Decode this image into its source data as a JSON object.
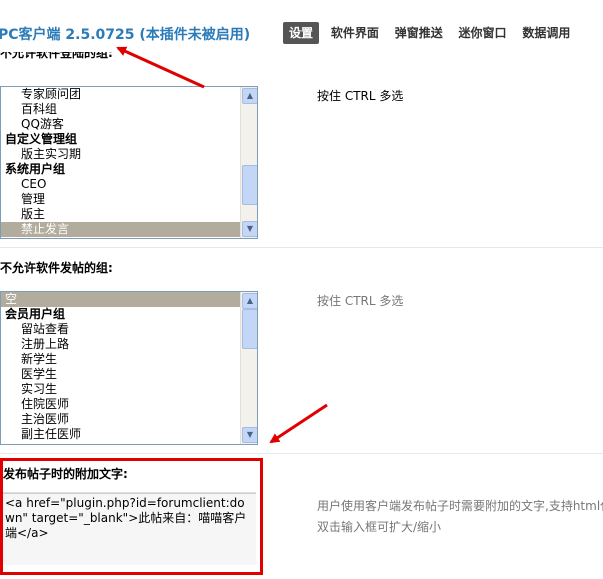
{
  "header": {
    "app_title": "PC客户端 2.5.0725 (本插件未被启用)",
    "tabs": [
      {
        "label": "设置",
        "active": true
      },
      {
        "label": "软件界面",
        "active": false
      },
      {
        "label": "弹窗推送",
        "active": false
      },
      {
        "label": "迷你窗口",
        "active": false
      },
      {
        "label": "数据调用",
        "active": false
      }
    ]
  },
  "section1": {
    "label": "不允许软件登陆的组:",
    "options": [
      {
        "text": "专家顾问团",
        "kind": "indent",
        "selected": false
      },
      {
        "text": "百科组",
        "kind": "indent",
        "selected": false
      },
      {
        "text": "QQ游客",
        "kind": "indent",
        "selected": false
      },
      {
        "text": "自定义管理组",
        "kind": "group",
        "selected": false
      },
      {
        "text": "版主实习期",
        "kind": "indent",
        "selected": false
      },
      {
        "text": "系统用户组",
        "kind": "group",
        "selected": false
      },
      {
        "text": "CEO",
        "kind": "indent",
        "selected": false
      },
      {
        "text": "管理",
        "kind": "indent",
        "selected": false
      },
      {
        "text": "版主",
        "kind": "indent",
        "selected": false
      },
      {
        "text": "禁止发言",
        "kind": "indent",
        "selected": true
      }
    ],
    "hint": "按住 CTRL 多选"
  },
  "section2": {
    "label": "不允许软件发帖的组:",
    "options": [
      {
        "text": "空",
        "kind": "plain",
        "selected": true
      },
      {
        "text": "会员用户组",
        "kind": "group",
        "selected": false
      },
      {
        "text": "留站查看",
        "kind": "indent",
        "selected": false
      },
      {
        "text": "注册上路",
        "kind": "indent",
        "selected": false
      },
      {
        "text": "新学生",
        "kind": "indent",
        "selected": false
      },
      {
        "text": "医学生",
        "kind": "indent",
        "selected": false
      },
      {
        "text": "实习生",
        "kind": "indent",
        "selected": false
      },
      {
        "text": "住院医师",
        "kind": "indent",
        "selected": false
      },
      {
        "text": "主治医师",
        "kind": "indent",
        "selected": false
      },
      {
        "text": "副主任医师",
        "kind": "indent",
        "selected": false
      }
    ],
    "hint": "按住 CTRL 多选"
  },
  "section3": {
    "label": "发布帖子时的附加文字:",
    "value": "<a href=\"plugin.php?id=forumclient:down\" target=\"_blank\">此帖来自：喵喵客户端</a>",
    "hint_line1": "用户使用客户端发布帖子时需要附加的文字,支持html代",
    "hint_line2": "双击输入框可扩大/缩小"
  },
  "colors": {
    "title": "#2b7bb9",
    "active_tab_bg": "#555555",
    "selected_option_bg": "#b1ac9c",
    "highlight_box": "#e00000",
    "arrow": "#e00000"
  }
}
